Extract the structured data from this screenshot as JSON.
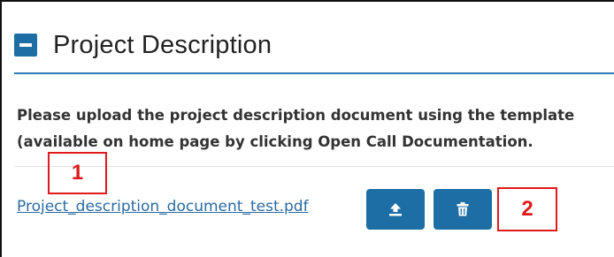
{
  "panel": {
    "title": "Project Description",
    "collapse_icon": "minus-icon",
    "accent_color": "#1c6ea4"
  },
  "instructions": {
    "line1": "Please upload the project description document using the template",
    "line2": "(available on home page by clicking Open Call Documentation."
  },
  "upload": {
    "file_name": "Project_description_document_test.pdf",
    "upload_icon": "upload-icon",
    "delete_icon": "trash-icon"
  },
  "annotations": {
    "marker_1": "1",
    "marker_2": "2",
    "color": "#e01a1a"
  }
}
